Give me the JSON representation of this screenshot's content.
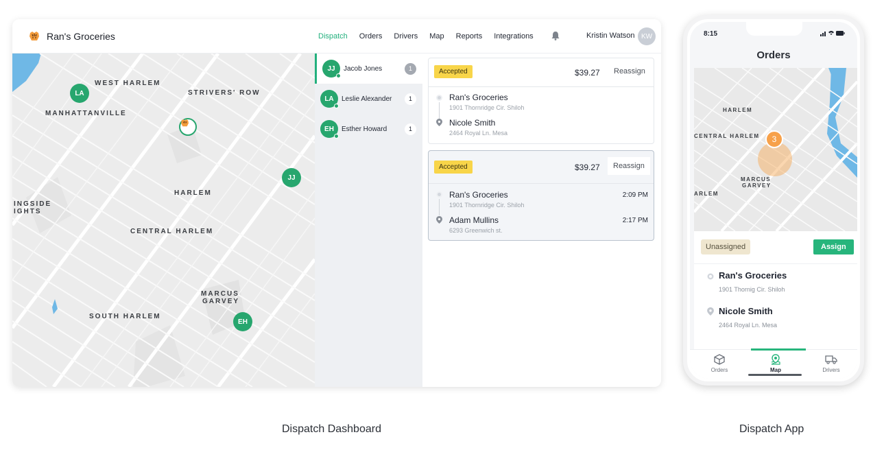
{
  "dashboard": {
    "brand": "Ran's Groceries",
    "nav": [
      "Dispatch",
      "Orders",
      "Drivers",
      "Map",
      "Reports",
      "Integrations"
    ],
    "active_nav": "Dispatch",
    "user_name": "Kristin Watson",
    "user_initials": "KW",
    "map": {
      "labels": [
        "WEST HARLEM",
        "STRIVERS' ROW",
        "MANHATTANVILLE",
        "HARLEM",
        "CENTRAL HARLEM",
        "MARCUS",
        "GARVEY",
        "SOUTH HARLEM",
        "INGSIDE",
        "IGHTS"
      ],
      "pins": [
        "LA",
        "JJ",
        "EH"
      ]
    },
    "drivers": [
      {
        "initials": "JJ",
        "name": "Jacob Jones",
        "count": "1"
      },
      {
        "initials": "LA",
        "name": "Leslie Alexander",
        "count": "1"
      },
      {
        "initials": "EH",
        "name": "Esther Howard",
        "count": "1"
      }
    ],
    "orders": [
      {
        "status": "Accepted",
        "price": "$39.27",
        "action": "Reassign",
        "pickup": {
          "name": "Ran's Groceries",
          "address": "1901 Thornridge Cir. Shiloh",
          "time": ""
        },
        "dropoff": {
          "name": "Nicole Smith",
          "address": "2464 Royal Ln. Mesa",
          "time": ""
        }
      },
      {
        "status": "Accepted",
        "price": "$39.27",
        "action": "Reassign",
        "pickup": {
          "name": "Ran's Groceries",
          "address": "1901 Thornridge Cir. Shiloh",
          "time": "2:09 PM"
        },
        "dropoff": {
          "name": "Adam Mullins",
          "address": "6293 Greenwich st.",
          "time": "2:17 PM"
        }
      }
    ]
  },
  "phone": {
    "time": "8:15",
    "title": "Orders",
    "map_labels": [
      "HARLEM",
      "CENTRAL HARLEM",
      "MARCUS",
      "GARVEY",
      "ARLEM"
    ],
    "cluster_count": "3",
    "status": "Unassigned",
    "assign_label": "Assign",
    "pickup": {
      "name": "Ran's Groceries",
      "address": "1901 Thornig Cir. Shiloh"
    },
    "dropoff": {
      "name": "Nicole Smith",
      "address": "2464 Royal Ln. Mesa"
    },
    "tabs": [
      "Orders",
      "Map",
      "Drivers"
    ],
    "active_tab": "Map"
  },
  "captions": {
    "dashboard": "Dispatch Dashboard",
    "app": "Dispatch App"
  },
  "colors": {
    "accent_green": "#27a66e",
    "badge_yellow": "#f8d549",
    "cluster_orange": "#f7a14a",
    "water_blue": "#6fb8e6"
  }
}
